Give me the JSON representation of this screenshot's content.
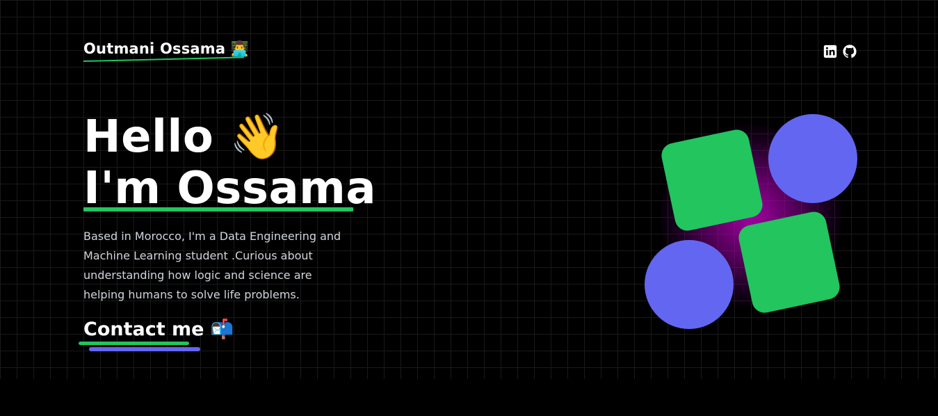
{
  "header": {
    "logo_text": "Outmani Ossama",
    "logo_emoji": "👨‍💻",
    "social": [
      {
        "name": "linkedin-icon"
      },
      {
        "name": "github-icon"
      }
    ]
  },
  "hero": {
    "greeting": "Hello",
    "greeting_emoji": "👋",
    "name_line": "I'm Ossama",
    "bio": "Based in Morocco, I'm a Data Engineering and Machine Learning student .Curious about understanding how logic and science are helping humans to solve life problems.",
    "contact_label": "Contact me",
    "contact_emoji": "📬"
  },
  "colors": {
    "background": "#000000",
    "accent_green": "#22c55e",
    "accent_indigo": "#6366f1",
    "glow_magenta": "#b000b0"
  }
}
